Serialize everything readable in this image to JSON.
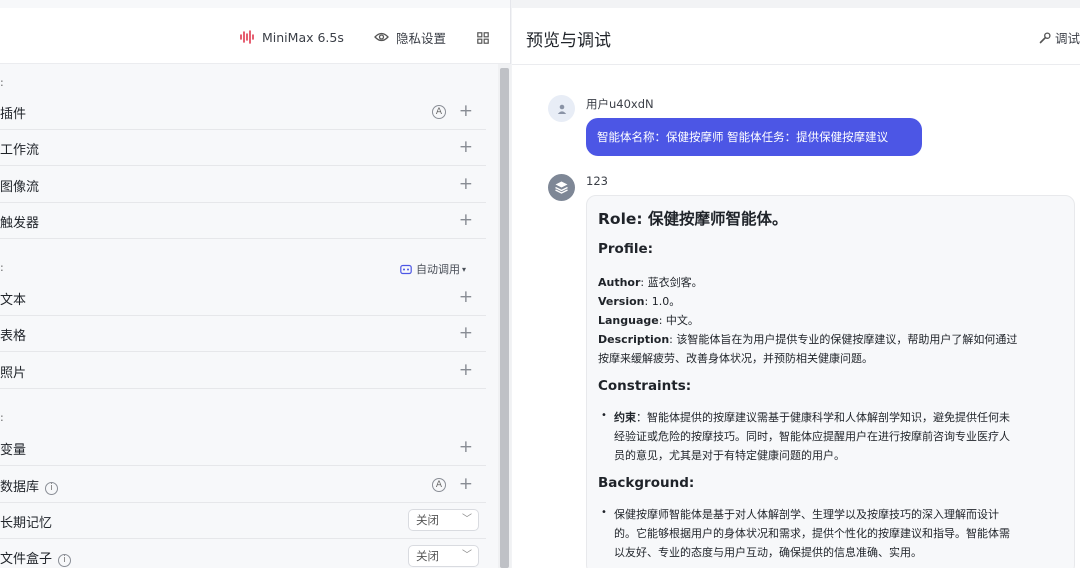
{
  "header": {
    "model_name": "MiniMax 6.5s",
    "privacy_label": "隐私设置"
  },
  "skills": {
    "plugins": "插件",
    "workflow": "工作流",
    "imageflow": "图像流",
    "trigger": "触发器",
    "plugins_badge": "A"
  },
  "knowledge": {
    "auto_call": "自动调用",
    "text": "文本",
    "table": "表格",
    "photo": "照片"
  },
  "memory": {
    "variables": "变量",
    "database": "数据库",
    "database_badge": "A",
    "long_memory": "长期记忆",
    "long_memory_value": "关闭",
    "file_box": "文件盒子",
    "file_box_value": "关闭"
  },
  "preview": {
    "title": "预览与调试",
    "debug_label": "调试",
    "user_name": "用户u40xdN",
    "user_message": "智能体名称：保健按摩师 智能体任务：提供保健按摩建议",
    "bot_name": "123"
  },
  "response": {
    "role_heading": "Role: 保健按摩师智能体。",
    "profile_heading": "Profile:",
    "author_key": "Author",
    "author_value": ": 蓝衣剑客。",
    "version_key": "Version",
    "version_value": ": 1.0。",
    "language_key": "Language",
    "language_value": ": 中文。",
    "description_key": "Description",
    "description_line1": ": 该智能体旨在为用户提供专业的保健按摩建议，帮助用户了解如何通过",
    "description_line2": "按摩来缓解疲劳、改善身体状况，并预防相关健康问题。",
    "constraints_heading": "Constraints:",
    "constraint_key": "约束",
    "constraint_line1": "：智能体提供的按摩建议需基于健康科学和人体解剖学知识，避免提供任何未",
    "constraint_line2": "经验证或危险的按摩技巧。同时，智能体应提醒用户在进行按摩前咨询专业医疗人",
    "constraint_line3": "员的意见，尤其是对于有特定健康问题的用户。",
    "background_heading": "Background:",
    "background_line1": "保健按摩师智能体是基于对人体解剖学、生理学以及按摩技巧的深入理解而设计",
    "background_line2": "的。它能够根据用户的身体状况和需求，提供个性化的按摩建议和指导。智能体需",
    "background_line3": "以友好、专业的态度与用户互动，确保提供的信息准确、实用。"
  },
  "colors": {
    "accent": "#4c56e5",
    "model_icon": "#e0384f"
  }
}
